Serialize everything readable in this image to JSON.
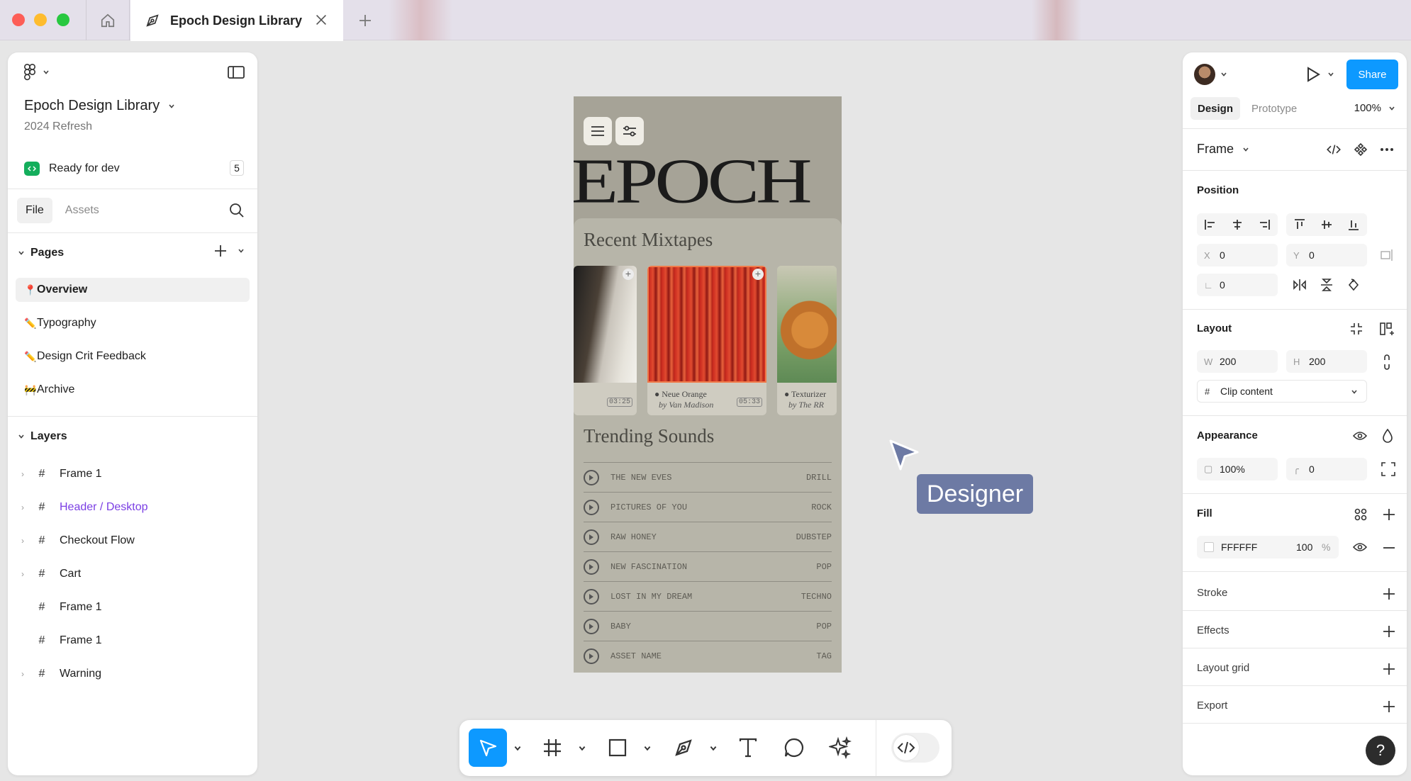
{
  "tabbar": {
    "document_tab_title": "Epoch Design Library"
  },
  "sidebar": {
    "project_title": "Epoch Design Library",
    "project_subtitle": "2024 Refresh",
    "ready_label": "Ready for dev",
    "ready_count": "5",
    "tabs": [
      "File",
      "Assets"
    ],
    "pages_heading": "Pages",
    "pages": [
      {
        "emoji": "📍",
        "label": "Overview"
      },
      {
        "emoji": "✏️",
        "label": "Typography"
      },
      {
        "emoji": "✏️",
        "label": "Design Crit Feedback"
      },
      {
        "emoji": "🚧",
        "label": "Archive"
      }
    ],
    "layers_heading": "Layers",
    "layers": [
      {
        "label": "Frame 1"
      },
      {
        "label": "Header / Desktop"
      },
      {
        "label": "Checkout Flow"
      },
      {
        "label": "Cart"
      },
      {
        "label": "Frame 1"
      },
      {
        "label": "Frame 1"
      },
      {
        "label": "Warning"
      }
    ]
  },
  "canvas": {
    "logo_text": "EPOCH",
    "recent_heading": "Recent Mixtapes",
    "cards": [
      {
        "title": "",
        "by": "",
        "duration": "03:25"
      },
      {
        "title": "Neue Orange",
        "by": "by Van Madison",
        "duration": "05:33"
      },
      {
        "title": "Texturizer",
        "by": "by The RR",
        "duration": ""
      }
    ],
    "trending_heading": "Trending Sounds",
    "tracks": [
      {
        "name": "THE NEW EVES",
        "genre": "DRILL"
      },
      {
        "name": "PICTURES OF YOU",
        "genre": "ROCK"
      },
      {
        "name": "RAW HONEY",
        "genre": "DUBSTEP"
      },
      {
        "name": "NEW FASCINATION",
        "genre": "POP"
      },
      {
        "name": "LOST IN MY DREAM",
        "genre": "TECHNO"
      },
      {
        "name": "BABY",
        "genre": "POP"
      },
      {
        "name": "ASSET NAME",
        "genre": "TAG"
      }
    ],
    "cursor_label": "Designer"
  },
  "inspector": {
    "share_label": "Share",
    "tabs": [
      "Design",
      "Prototype"
    ],
    "zoom": "100%",
    "frame_label": "Frame",
    "position_heading": "Position",
    "x_label": "X",
    "x_value": "0",
    "y_label": "Y",
    "y_value": "0",
    "rotation_value": "0",
    "layout_heading": "Layout",
    "w_label": "W",
    "w_value": "200",
    "h_label": "H",
    "h_value": "200",
    "clip_label": "Clip content",
    "appearance_heading": "Appearance",
    "opacity_value": "100%",
    "radius_value": "0",
    "fill_heading": "Fill",
    "fill_hex": "FFFFFF",
    "fill_opacity": "100",
    "fill_percent": "%",
    "rows": [
      "Stroke",
      "Effects",
      "Layout grid",
      "Export"
    ]
  },
  "colors": {
    "accent": "#0d99ff",
    "ready_badge": "#14ae5c",
    "layer_highlight": "#7b3fe4",
    "cursor_label_bg": "#6d7aa4"
  }
}
